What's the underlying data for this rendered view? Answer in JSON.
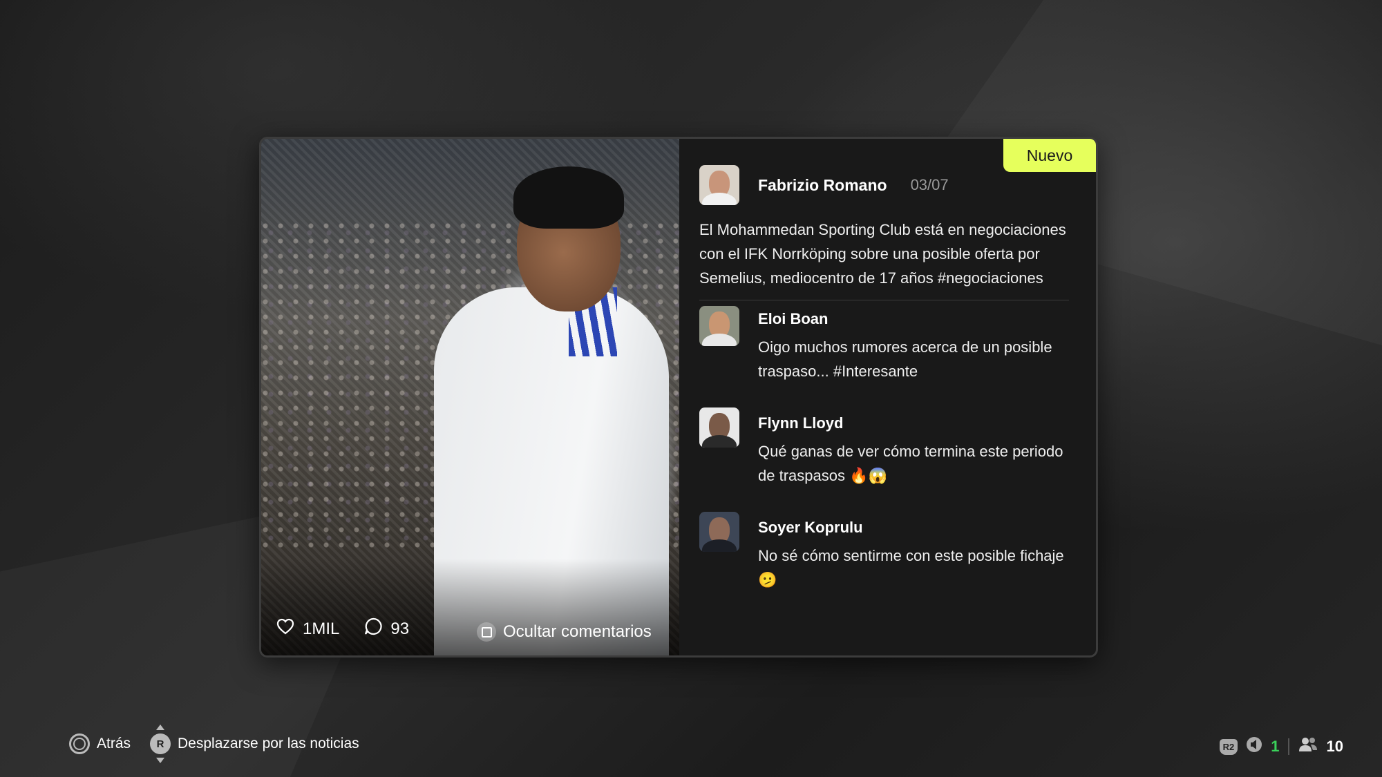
{
  "post": {
    "badge": "Nuevo",
    "author": "Fabrizio Romano",
    "date": "03/07",
    "text": "El Mohammedan Sporting Club está en negociaciones con el IFK Norrköping sobre una posible oferta por Semelius, mediocentro de 17 años #negociaciones",
    "likes": "1MIL",
    "comments_count": "93",
    "hide_comments_label": "Ocultar comentarios",
    "accent_color": "#e6ff5c"
  },
  "comments": [
    {
      "author": "Eloi Boan",
      "text": "Oigo muchos rumores acerca de un posible traspaso... #Interesante"
    },
    {
      "author": "Flynn Lloyd",
      "text": "Qué ganas de ver cómo termina este periodo de traspasos 🔥😱"
    },
    {
      "author": "Soyer Koprulu",
      "text": "No sé cómo sentirme con este posible fichaje 🫤"
    }
  ],
  "footer": {
    "back_label": "Atrás",
    "scroll_label": "Desplazarse por las noticias",
    "r_button": "R"
  },
  "hud": {
    "r2_label": "R2",
    "notifications": "1",
    "players": "10"
  },
  "icons": [
    "heart-icon",
    "comment-bubble-icon",
    "square-button-icon",
    "circle-button-icon",
    "right-stick-icon",
    "speaker-icon",
    "people-icon"
  ]
}
